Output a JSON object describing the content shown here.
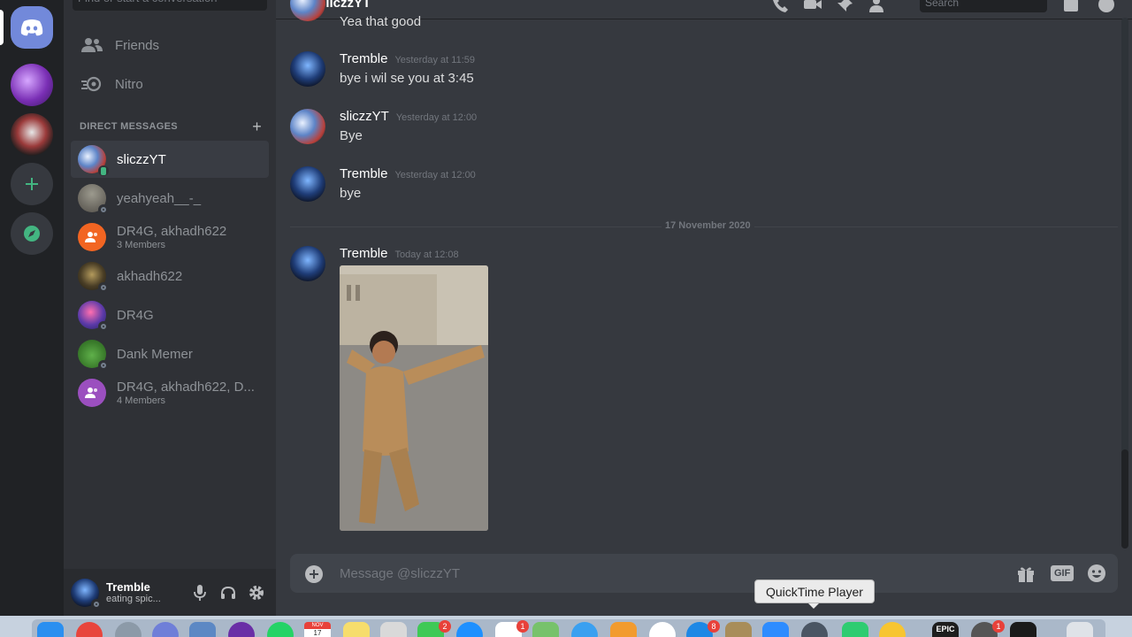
{
  "sidebar": {
    "search_placeholder": "Find or start a conversation",
    "nav": {
      "friends": "Friends",
      "nitro": "Nitro"
    },
    "dm_header": "DIRECT MESSAGES",
    "dms": [
      {
        "name": "sliczzYT",
        "sub": "",
        "active": true
      },
      {
        "name": "yeahyeah__-_",
        "sub": ""
      },
      {
        "name": "DR4G, akhadh622",
        "sub": "3 Members"
      },
      {
        "name": "akhadh622",
        "sub": ""
      },
      {
        "name": "DR4G",
        "sub": ""
      },
      {
        "name": "Dank Memer",
        "sub": ""
      },
      {
        "name": "DR4G, akhadh622, D...",
        "sub": "4 Members"
      }
    ]
  },
  "user_panel": {
    "name": "Tremble",
    "status": "eating spic..."
  },
  "chat": {
    "title": "sliczzYT",
    "search_placeholder": "Search",
    "partial_message": "Yea that good",
    "messages": [
      {
        "author": "Tremble",
        "time": "Yesterday at 11:59",
        "text": "bye i wil se you at 3:45"
      },
      {
        "author": "sliczzYT",
        "time": "Yesterday at 12:00",
        "text": "Bye"
      },
      {
        "author": "Tremble",
        "time": "Yesterday at 12:00",
        "text": "bye"
      },
      {
        "author": "Tremble",
        "time": "Today at 12:08",
        "text": ""
      }
    ],
    "date_divider": "17 November 2020",
    "composer_placeholder": "Message @sliczzYT",
    "gif_label": "GIF"
  },
  "tooltip": "QuickTime Player",
  "dock": {
    "calendar_month": "NOV",
    "calendar_day": "17",
    "badges": {
      "facetime": "2",
      "reminders": "1",
      "appstore": "8",
      "activity": "1"
    },
    "epic_label": "EPIC"
  },
  "colors": {
    "blurple": "#7289da",
    "green": "#43b581",
    "chat_bg": "#36393f",
    "sidebar_bg": "#2f3136",
    "rail_bg": "#202225"
  }
}
